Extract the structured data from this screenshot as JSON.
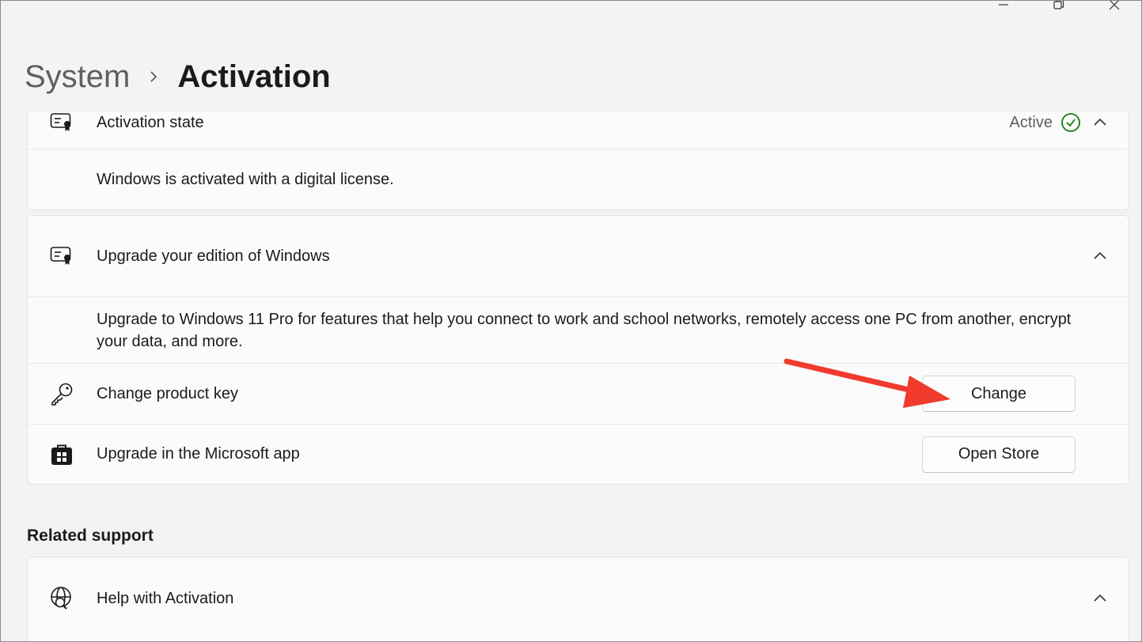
{
  "breadcrumb": {
    "parent": "System",
    "current": "Activation"
  },
  "activation_state": {
    "label": "Activation state",
    "value": "Active",
    "message": "Windows is activated with a digital license."
  },
  "upgrade": {
    "title": "Upgrade your edition of Windows",
    "description": "Upgrade to Windows 11 Pro for features that help you connect to work and school networks, remotely access one PC from another, encrypt your data, and more.",
    "change_key": {
      "label": "Change product key",
      "button": "Change"
    },
    "store": {
      "label": "Upgrade in the Microsoft app",
      "button": "Open Store"
    }
  },
  "related": {
    "title": "Related support",
    "help": {
      "label": "Help with Activation"
    }
  },
  "colors": {
    "accent_green": "#107c10",
    "annotation_arrow": "#f03a2e"
  }
}
